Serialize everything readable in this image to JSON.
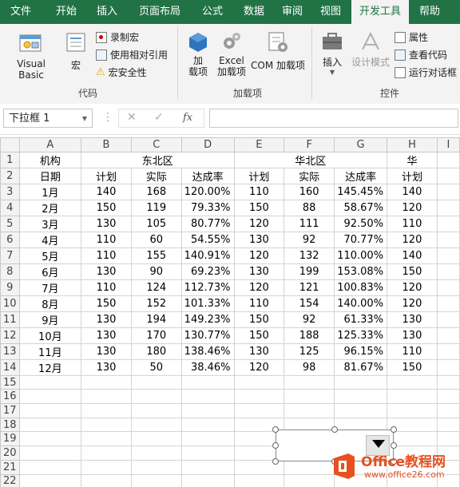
{
  "tabs": [
    "文件",
    "开始",
    "插入",
    "页面布局",
    "公式",
    "数据",
    "审阅",
    "视图",
    "开发工具",
    "帮助"
  ],
  "active_tab": "开发工具",
  "ribbon": {
    "code": {
      "label": "代码",
      "visual_basic": "Visual Basic",
      "macros": "宏",
      "record_macro": "录制宏",
      "relative_ref": "使用相对引用",
      "macro_security": "宏安全性"
    },
    "addins": {
      "label": "加载项",
      "addins_btn": "加\n载项",
      "excel_addins": "Excel\n加载项",
      "com_addins": "COM 加载项"
    },
    "controls": {
      "label": "控件",
      "insert": "插入",
      "design_mode": "设计模式",
      "properties": "属性",
      "view_code": "查看代码",
      "run_dialog": "运行对话框"
    }
  },
  "namebox": "下拉框 1",
  "fx": "fx",
  "columns": [
    "A",
    "B",
    "C",
    "D",
    "E",
    "F",
    "G",
    "H",
    "I"
  ],
  "rows": [
    [
      "机构",
      "东北区",
      "",
      "",
      "华北区",
      "",
      "",
      "华"
    ],
    [
      "日期",
      "计划",
      "实际",
      "达成率",
      "计划",
      "实际",
      "达成率",
      "计划"
    ],
    [
      "1月",
      "140",
      "168",
      "120.00%",
      "110",
      "160",
      "145.45%",
      "140"
    ],
    [
      "2月",
      "150",
      "119",
      "79.33%",
      "150",
      "88",
      "58.67%",
      "120"
    ],
    [
      "3月",
      "130",
      "105",
      "80.77%",
      "120",
      "111",
      "92.50%",
      "110"
    ],
    [
      "4月",
      "110",
      "60",
      "54.55%",
      "130",
      "92",
      "70.77%",
      "120"
    ],
    [
      "5月",
      "110",
      "155",
      "140.91%",
      "120",
      "132",
      "110.00%",
      "140"
    ],
    [
      "6月",
      "130",
      "90",
      "69.23%",
      "130",
      "199",
      "153.08%",
      "150"
    ],
    [
      "7月",
      "110",
      "124",
      "112.73%",
      "120",
      "121",
      "100.83%",
      "120"
    ],
    [
      "8月",
      "150",
      "152",
      "101.33%",
      "110",
      "154",
      "140.00%",
      "120"
    ],
    [
      "9月",
      "130",
      "194",
      "149.23%",
      "150",
      "92",
      "61.33%",
      "130"
    ],
    [
      "10月",
      "130",
      "170",
      "130.77%",
      "150",
      "188",
      "125.33%",
      "130"
    ],
    [
      "11月",
      "130",
      "180",
      "138.46%",
      "130",
      "125",
      "96.15%",
      "110"
    ],
    [
      "12月",
      "130",
      "50",
      "38.46%",
      "120",
      "98",
      "81.67%",
      "150"
    ]
  ],
  "empty_rows": [
    "15",
    "16",
    "17",
    "18",
    "19",
    "20",
    "21",
    "22"
  ],
  "watermark": {
    "brand": "Office教程网",
    "url": "www.office26.com"
  },
  "colors": {
    "excel_green": "#217346",
    "ribbon_bg": "#f3f3f3",
    "watermark_orange": "#e8501f"
  }
}
